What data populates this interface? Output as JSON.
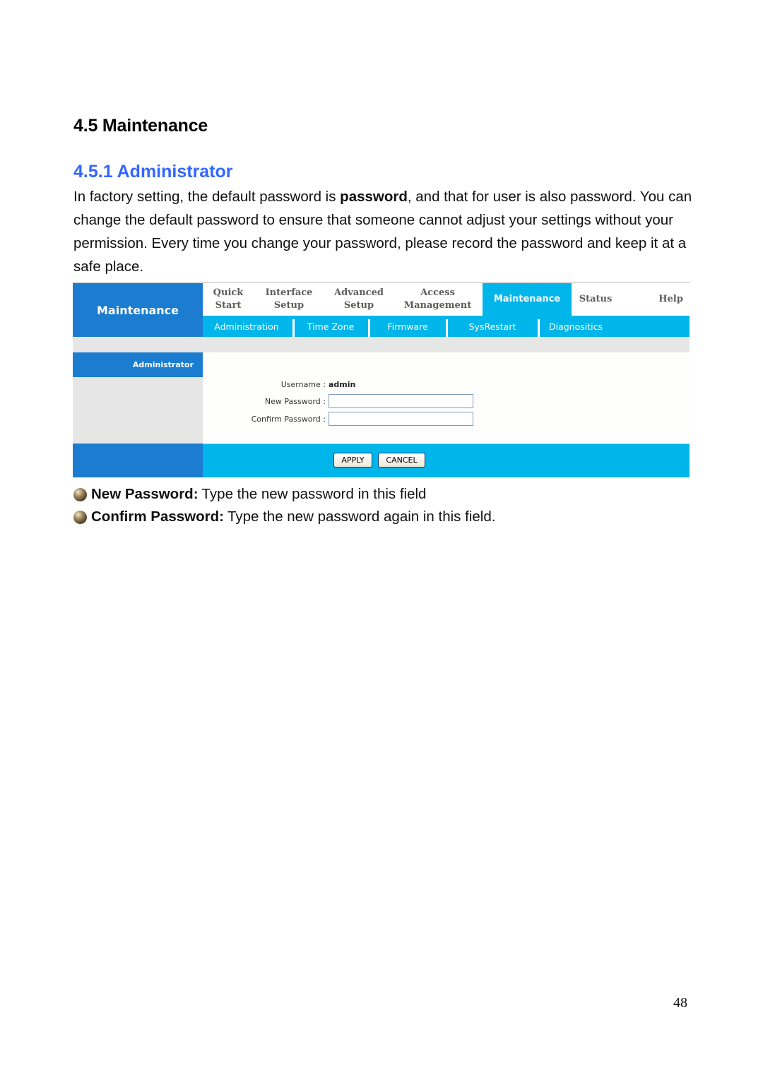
{
  "document": {
    "section_title": "4.5 Maintenance",
    "subsection_title": "4.5.1 Administrator",
    "paragraph": {
      "part1": "In factory setting, the default password is ",
      "bold": "password",
      "part2": ", and that for user is also password. You can change the default password to ensure that someone cannot adjust your settings without your permission. Every time you change your password, please record the password and keep it at a safe place."
    },
    "bullets": [
      {
        "icon": "bullet-ball-icon",
        "term": "New Password:",
        "text": "Type the new password in this field"
      },
      {
        "icon": "bullet-ball-icon",
        "term": "Confirm Password:",
        "text": "Type the new password again in this field."
      }
    ],
    "page_number": "48"
  },
  "router_ui": {
    "brand": "Maintenance",
    "main_tabs": [
      {
        "line1": "Quick",
        "line2": "Start"
      },
      {
        "line1": "Interface",
        "line2": "Setup"
      },
      {
        "line1": "Advanced",
        "line2": "Setup"
      },
      {
        "line1": "Access",
        "line2": "Management"
      },
      {
        "line1": "Maintenance",
        "line2": "",
        "active": true
      },
      {
        "line1": "Status",
        "line2": ""
      },
      {
        "line1": "Help",
        "line2": ""
      }
    ],
    "sub_tabs": [
      "Administration",
      "Time Zone",
      "Firmware",
      "SysRestart",
      "Diagnositics"
    ],
    "sidebar_heading": "Administrator",
    "form": {
      "username_label": "Username :",
      "username_value": "admin",
      "new_password_label": "New Password :",
      "new_password_value": "",
      "confirm_password_label": "Confirm Password :",
      "confirm_password_value": ""
    },
    "buttons": {
      "apply": "APPLY",
      "cancel": "CANCEL"
    },
    "colors": {
      "dark_blue": "#1c7ccf",
      "light_blue": "#00b5ea",
      "gray": "#e6e6e6"
    }
  }
}
